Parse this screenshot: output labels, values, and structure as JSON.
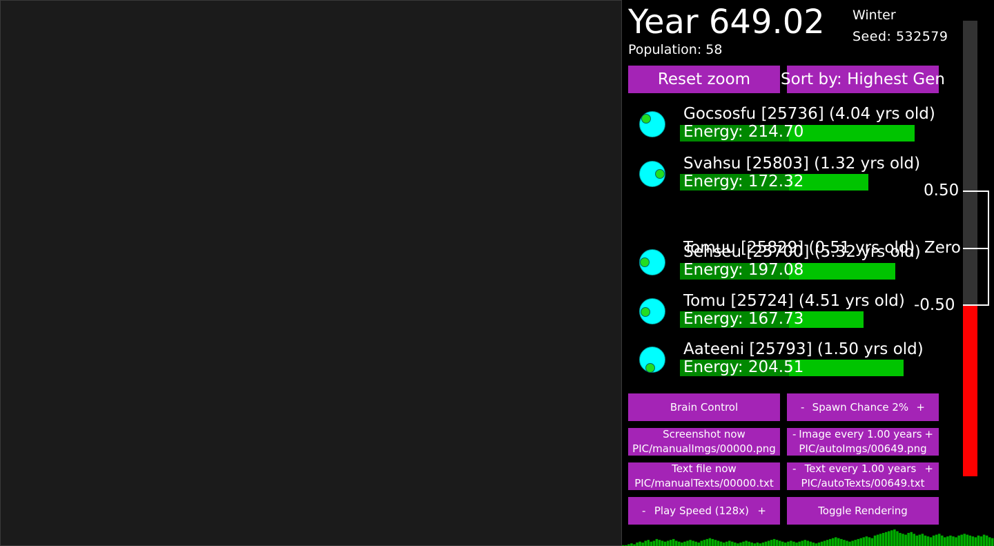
{
  "header": {
    "year": "Year 649.02",
    "population": "Population: 58",
    "season": "Winter",
    "seed": "Seed: 532579"
  },
  "top_buttons": {
    "reset_zoom": "Reset zoom",
    "sort_by": "Sort by: Highest Gen"
  },
  "creatures": [
    {
      "name": "Gocsosfu [25736] (4.04 yrs old)",
      "energy": "Energy: 214.70",
      "energy_value": 214.7
    },
    {
      "name": "Svahsu [25803] (1.32 yrs old)",
      "energy": "Energy: 172.32",
      "energy_value": 172.32
    },
    {
      "name": "Tomuu [25829] (0.51 yrs old)",
      "energy": "Energy: 197.08",
      "energy_value": 197.08
    },
    {
      "name": "Sehseu [25700] (5.32 yrs old)",
      "energy": "",
      "energy_value": null
    },
    {
      "name": "Tomu [25724] (4.51 yrs old)",
      "energy": "Energy: 167.73",
      "energy_value": 167.73
    },
    {
      "name": "Aateeni [25793] (1.50 yrs old)",
      "energy": "Energy: 204.51",
      "energy_value": 204.51
    }
  ],
  "controls": {
    "brain_control": "Brain Control",
    "spawn_minus": "-",
    "spawn_label": "Spawn Chance 2%",
    "spawn_plus": "+",
    "screenshot_now": "Screenshot now",
    "screenshot_path": "PIC/manualImgs/00000.png",
    "image_minus": "-",
    "image_label": "Image every 1.00 years",
    "image_plus": "+",
    "image_path": "PIC/autoImgs/00649.png",
    "textfile_now": "Text file now",
    "textfile_path": "PIC/manualTexts/00000.txt",
    "text_minus": "-",
    "text_label": "Text every 1.00 years",
    "text_plus": "+",
    "text_path": "PIC/autoTexts/00649.txt",
    "speed_minus": "-",
    "speed_label": "Play Speed (128x)",
    "speed_plus": "+",
    "toggle_rendering": "Toggle Rendering"
  },
  "scale": {
    "top_label": "0.50",
    "mid_label": "Zero",
    "bottom_label": "-0.50",
    "colors": {
      "track": "#333333",
      "value": "#ff0000",
      "accent": "#a424b6"
    }
  },
  "histogram": {
    "color": "#00aa00",
    "values": [
      1,
      1,
      2,
      3,
      2,
      4,
      5,
      4,
      6,
      7,
      5,
      6,
      8,
      7,
      6,
      5,
      6,
      7,
      8,
      6,
      5,
      4,
      5,
      6,
      7,
      6,
      5,
      4,
      6,
      7,
      8,
      9,
      8,
      7,
      6,
      5,
      4,
      5,
      6,
      5,
      4,
      3,
      4,
      5,
      6,
      5,
      4,
      3,
      4,
      3,
      4,
      5,
      6,
      7,
      8,
      7,
      6,
      5,
      4,
      5,
      6,
      5,
      4,
      5,
      6,
      7,
      6,
      5,
      4,
      3,
      4,
      5,
      6,
      7,
      8,
      9,
      10,
      9,
      8,
      7,
      6,
      5,
      6,
      7,
      8,
      9,
      10,
      11,
      10,
      9,
      12,
      13,
      14,
      15,
      16,
      17,
      18,
      19,
      17,
      15,
      14,
      13,
      15,
      16,
      14,
      12,
      13,
      14,
      12,
      11,
      10,
      12,
      13,
      14,
      12,
      10,
      11,
      12,
      11,
      10,
      12,
      13,
      14,
      13,
      12,
      11,
      10,
      12,
      11,
      13,
      12,
      10,
      9
    ]
  }
}
